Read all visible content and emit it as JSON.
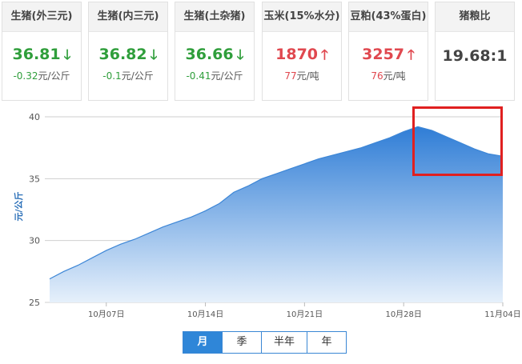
{
  "cards": [
    {
      "title": "生猪(外三元)",
      "value": "36.81",
      "trend": "down",
      "change": "-0.32",
      "unit": "元/公斤"
    },
    {
      "title": "生猪(内三元)",
      "value": "36.82",
      "trend": "down",
      "change": "-0.1",
      "unit": "元/公斤"
    },
    {
      "title": "生猪(土杂猪)",
      "value": "36.66",
      "trend": "down",
      "change": "-0.41",
      "unit": "元/公斤"
    },
    {
      "title": "玉米(15%水分)",
      "value": "1870",
      "trend": "up",
      "change": "77",
      "unit": "元/吨"
    },
    {
      "title": "豆粕(43%蛋白)",
      "value": "3257",
      "trend": "up",
      "change": "76",
      "unit": "元/吨"
    },
    {
      "title": "猪粮比",
      "value": "19.68:1",
      "trend": "none",
      "change": "",
      "unit": ""
    }
  ],
  "icons": {
    "down": "arrow-down-icon",
    "up": "arrow-up-icon"
  },
  "colors": {
    "down": "#2f9e3b",
    "up": "#e0484f",
    "accent": "#2f86d8",
    "highlight": "#e02020"
  },
  "chart_data": {
    "type": "area",
    "ylabel": "元/公斤",
    "ylim": [
      25,
      40
    ],
    "yticks": [
      25,
      30,
      35,
      40
    ],
    "xlim": [
      "2019-10-03",
      "2019-11-04"
    ],
    "xticks": [
      "10月07日",
      "10月14日",
      "10月21日",
      "10月28日",
      "11月04日"
    ],
    "xtick_dates": [
      "2019-10-07",
      "2019-10-14",
      "2019-10-21",
      "2019-10-28",
      "2019-11-04"
    ],
    "grid": true,
    "x": [
      "2019-10-03",
      "2019-10-04",
      "2019-10-05",
      "2019-10-06",
      "2019-10-07",
      "2019-10-08",
      "2019-10-09",
      "2019-10-10",
      "2019-10-11",
      "2019-10-12",
      "2019-10-13",
      "2019-10-14",
      "2019-10-15",
      "2019-10-16",
      "2019-10-17",
      "2019-10-18",
      "2019-10-19",
      "2019-10-20",
      "2019-10-21",
      "2019-10-22",
      "2019-10-23",
      "2019-10-24",
      "2019-10-25",
      "2019-10-26",
      "2019-10-27",
      "2019-10-28",
      "2019-10-29",
      "2019-10-30",
      "2019-10-31",
      "2019-11-01",
      "2019-11-02",
      "2019-11-03",
      "2019-11-04"
    ],
    "values": [
      26.9,
      27.5,
      28.0,
      28.6,
      29.2,
      29.7,
      30.1,
      30.6,
      31.1,
      31.5,
      31.9,
      32.4,
      33.0,
      33.9,
      34.4,
      35.0,
      35.4,
      35.8,
      36.2,
      36.6,
      36.9,
      37.2,
      37.5,
      37.9,
      38.3,
      38.8,
      39.2,
      38.9,
      38.4,
      37.9,
      37.4,
      37.0,
      36.81
    ]
  },
  "range_tabs": [
    {
      "label": "月",
      "active": true
    },
    {
      "label": "季",
      "active": false
    },
    {
      "label": "半年",
      "active": false
    },
    {
      "label": "年",
      "active": false
    }
  ]
}
